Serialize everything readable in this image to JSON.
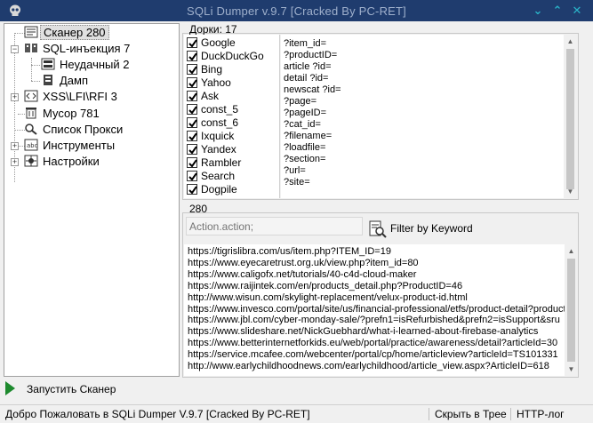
{
  "window": {
    "title": "SQLi Dumper v.9.7 [Cracked By PC-RET]"
  },
  "tree": {
    "scanner": "Сканер  280",
    "sqli": "SQL-инъекция  7",
    "failed": "Неудачный  2",
    "dump": "Дамп",
    "xss": "XSS\\LFI\\RFI  3",
    "trash": "Мусор  781",
    "proxy": "Список Прокси",
    "tools": "Инструменты",
    "settings": "Настройки"
  },
  "dorks": {
    "label": "Дорки:  17",
    "engines": [
      "Google",
      "DuckDuckGo",
      "Bing",
      "Yahoo",
      "Ask",
      "const_5",
      "const_6",
      "Ixquick",
      "Yandex",
      "Rambler",
      "Search",
      "Dogpile"
    ],
    "items": [
      "?item_id=",
      "?productID=",
      "article ?id=",
      "detail ?id=",
      "newscat ?id=",
      "?page=",
      "?pageID=",
      "?cat_id=",
      "?filename=",
      "?loadfile=",
      "?section=",
      "?url=",
      "?site="
    ]
  },
  "results": {
    "count_label": "280",
    "filter_placeholder": "Action.action;",
    "filter_button": "Filter by Keyword",
    "urls": [
      "https://tigrislibra.com/us/item.php?ITEM_ID=19",
      "https://www.eyecaretrust.org.uk/view.php?item_id=80",
      "https://www.caligofx.net/tutorials/40-c4d-cloud-maker",
      "https://www.raijintek.com/en/products_detail.php?ProductID=46",
      "http://www.wisun.com/skylight-replacement/velux-product-id.html",
      "https://www.invesco.com/portal/site/us/financial-professional/etfs/product-detail?productI",
      "https://www.jbl.com/cyber-monday-sale/?prefn1=isRefurbished&prefn2=isSupport&sru",
      "https://www.slideshare.net/NickGuebhard/what-i-learned-about-firebase-analytics",
      "https://www.betterinternetforkids.eu/web/portal/practice/awareness/detail?articleId=30",
      "https://service.mcafee.com/webcenter/portal/cp/home/articleview?articleId=TS101331",
      "http://www.earlychildhoodnews.com/earlychildhood/article_view.aspx?ArticleID=618"
    ]
  },
  "actions": {
    "start_scanner": "Запустить Сканер"
  },
  "status": {
    "message": "Добро Пожаловать в SQLi Dumper V.9.7 [Cracked By PC-RET]",
    "tray": "Скрыть в Трее",
    "http_log": "HTTP-лог"
  },
  "icons": {
    "app": "skull-icon",
    "minimize": "chevron-down-icon",
    "maximize": "chevron-up-icon",
    "close": "close-icon",
    "scanner": "scanner-icon",
    "database": "database-icon",
    "xss": "code-icon",
    "trash": "trash-icon",
    "proxy": "search-icon",
    "tools": "tools-icon",
    "settings": "settings-icon",
    "filter": "filter-search-icon",
    "start": "play-icon"
  },
  "colors": {
    "titlebar": "#1f3c6e",
    "title_text": "#9fb0cc",
    "window_controls": "#2ab3c8",
    "play": "#1e8a2e"
  }
}
